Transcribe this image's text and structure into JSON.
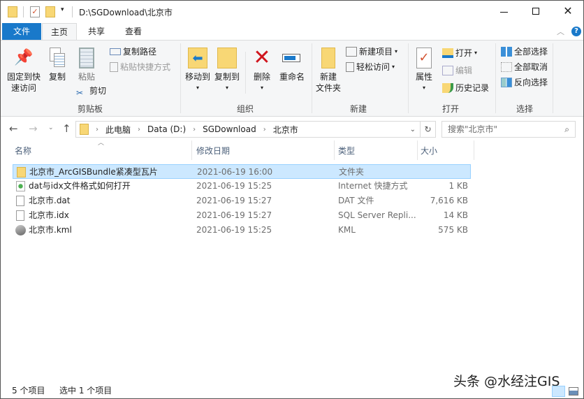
{
  "window": {
    "title": "D:\\SGDownload\\北京市"
  },
  "ribbon_tabs": {
    "file": "文件",
    "home": "主页",
    "share": "共享",
    "view": "查看"
  },
  "ribbon": {
    "clipboard": {
      "label": "剪贴板",
      "pin": [
        "固定到快",
        "速访问"
      ],
      "copy": "复制",
      "paste": "粘贴",
      "cut": "剪切",
      "copy_path": "复制路径",
      "paste_shortcut": "粘贴快捷方式"
    },
    "organize": {
      "label": "组织",
      "move_to": "移动到",
      "copy_to": "复制到",
      "delete": "删除",
      "rename": "重命名"
    },
    "new": {
      "label": "新建",
      "new_folder": [
        "新建",
        "文件夹"
      ],
      "new_item": "新建项目",
      "easy_access": "轻松访问"
    },
    "open": {
      "label": "打开",
      "properties": "属性",
      "open": "打开",
      "edit": "编辑",
      "history": "历史记录"
    },
    "select": {
      "label": "选择",
      "select_all": "全部选择",
      "select_none": "全部取消",
      "invert": "反向选择"
    }
  },
  "address": {
    "crumbs": [
      "此电脑",
      "Data (D:)",
      "SGDownload",
      "北京市"
    ],
    "search_placeholder": "搜索\"北京市\""
  },
  "columns": {
    "name": "名称",
    "date": "修改日期",
    "type": "类型",
    "size": "大小"
  },
  "files": [
    {
      "name": "北京市_ArcGISBundle紧凑型瓦片",
      "date": "2021-06-19 16:00",
      "type": "文件夹",
      "size": "",
      "icon": "folder",
      "selected": true
    },
    {
      "name": "dat与idx文件格式如何打开",
      "date": "2021-06-19 15:25",
      "type": "Internet 快捷方式",
      "size": "1 KB",
      "icon": "internet-shortcut"
    },
    {
      "name": "北京市.dat",
      "date": "2021-06-19 15:27",
      "type": "DAT 文件",
      "size": "7,616 KB",
      "icon": "file"
    },
    {
      "name": "北京市.idx",
      "date": "2021-06-19 15:27",
      "type": "SQL Server Repli...",
      "size": "14 KB",
      "icon": "file"
    },
    {
      "name": "北京市.kml",
      "date": "2021-06-19 15:25",
      "type": "KML",
      "size": "575 KB",
      "icon": "kml"
    }
  ],
  "status": {
    "count": "5 个项目",
    "selected": "选中 1 个项目"
  },
  "watermark": "头条 @水经注GIS",
  "colors": {
    "accent": "#1979ca",
    "selection": "#cce8ff",
    "folder": "#f8d775"
  }
}
